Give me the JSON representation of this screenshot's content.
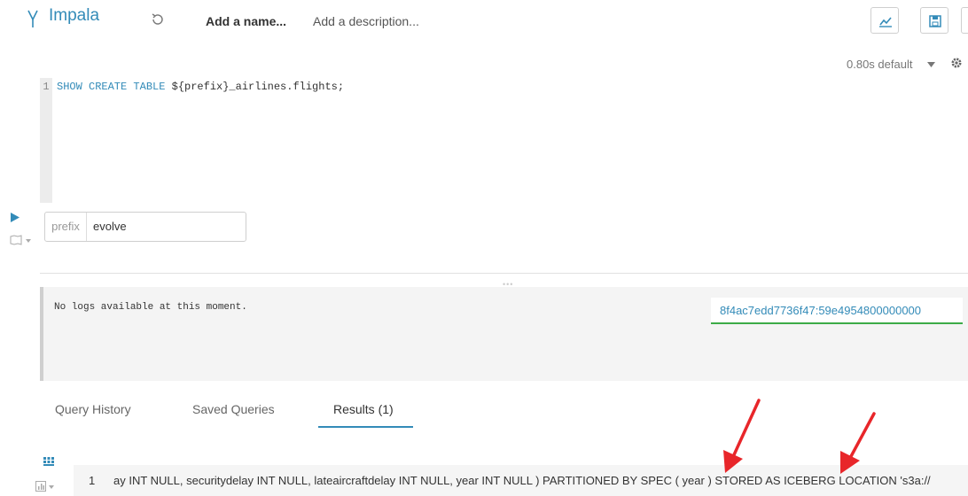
{
  "header": {
    "app_title": "Impala",
    "name_placeholder": "Add a name...",
    "description_placeholder": "Add a description..."
  },
  "editor": {
    "timing": "0.80s default",
    "line_number": "1",
    "code_keyword": "SHOW CREATE TABLE",
    "code_rest": " ${prefix}_airlines.flights;"
  },
  "parameter": {
    "label": "prefix",
    "value": "evolve"
  },
  "logs": {
    "message": "No logs available at this moment.",
    "query_id": "8f4ac7edd7736f47:59e4954800000000"
  },
  "tabs": [
    {
      "label": "Query History"
    },
    {
      "label": "Saved Queries"
    },
    {
      "label": "Results (1)"
    }
  ],
  "results": {
    "row_number": "1",
    "row_text": "ay INT NULL,  securitydelay INT NULL,  lateaircraftdelay INT NULL,  year INT NULL ) PARTITIONED BY SPEC (  year ) STORED AS ICEBERG LOCATION 's3a://"
  },
  "colors": {
    "accent": "#338bb8",
    "annotation_arrow": "#e8262a",
    "query_id_underline": "#3cab47"
  }
}
